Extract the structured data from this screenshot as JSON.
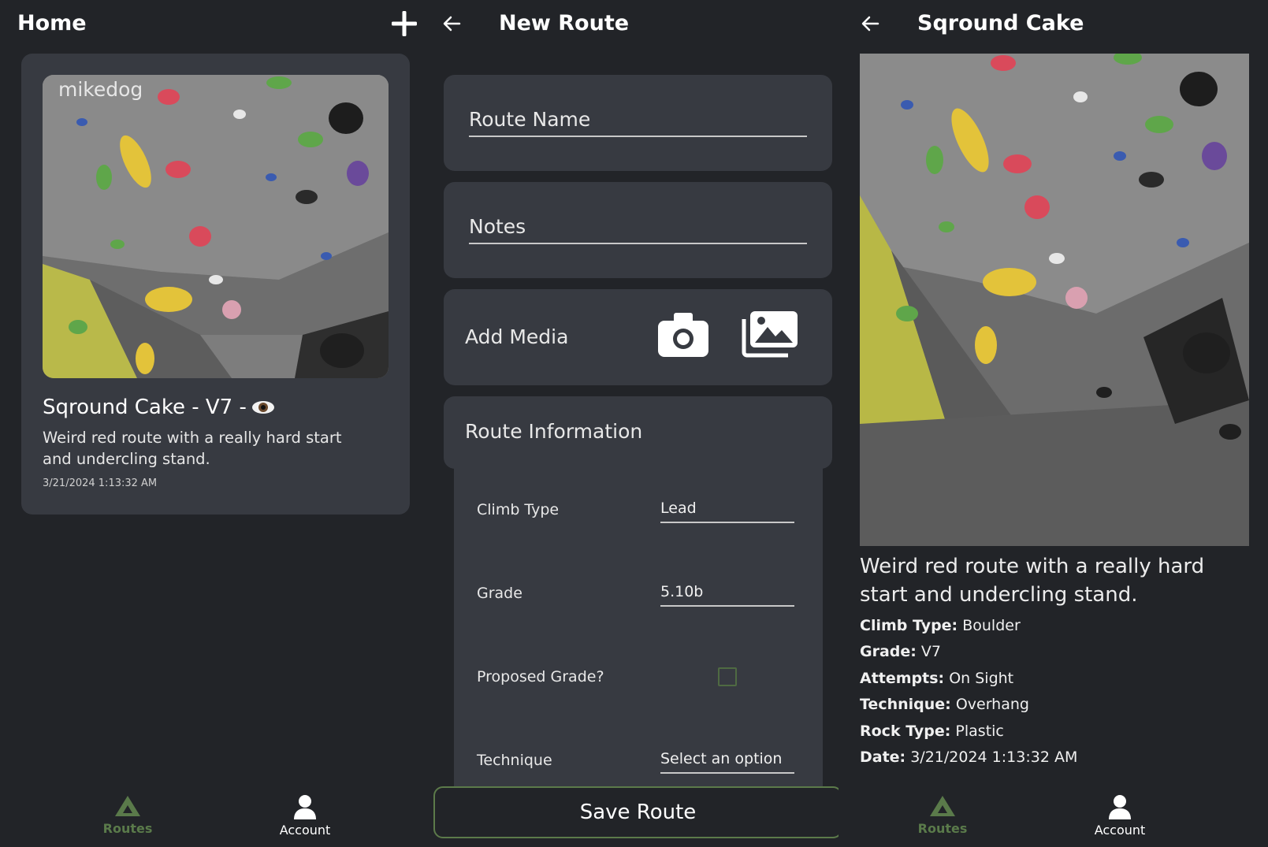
{
  "home": {
    "title": "Home",
    "card": {
      "user": "mikedog",
      "title": "Sqround Cake - V7 -",
      "description": "Weird red route with a really hard start and undercling stand.",
      "date": "3/21/2024 1:13:32 AM"
    }
  },
  "new_route": {
    "title": "New Route",
    "route_name_placeholder": "Route Name",
    "notes_placeholder": "Notes",
    "add_media_label": "Add Media",
    "route_info_header": "Route Information",
    "fields": {
      "climb_type_label": "Climb Type",
      "climb_type_value": "Lead",
      "grade_label": "Grade",
      "grade_value": "5.10b",
      "proposed_grade_label": "Proposed Grade?",
      "technique_label": "Technique",
      "technique_value": "Select an option"
    },
    "save_label": "Save Route"
  },
  "detail": {
    "title": "Sqround Cake",
    "description": "Weird red route with a really hard start and undercling stand.",
    "climb_type_key": "Climb Type:",
    "climb_type": "Boulder",
    "grade_key": "Grade:",
    "grade": "V7",
    "attempts_key": "Attempts:",
    "attempts": "On Sight",
    "technique_key": "Technique:",
    "technique": "Overhang",
    "rock_type_key": "Rock Type:",
    "rock_type": "Plastic",
    "date_key": "Date:",
    "date": "3/21/2024 1:13:32 AM"
  },
  "nav": {
    "routes_label": "Routes",
    "account_label": "Account"
  },
  "icons": [
    "plus-icon",
    "back-arrow-icon",
    "eye-icon",
    "camera-icon",
    "gallery-icon",
    "mountain-icon",
    "person-icon"
  ],
  "colors": {
    "background": "#222428",
    "card": "#373a41",
    "accent_green": "#5a7a4a",
    "text": "#ffffff"
  }
}
